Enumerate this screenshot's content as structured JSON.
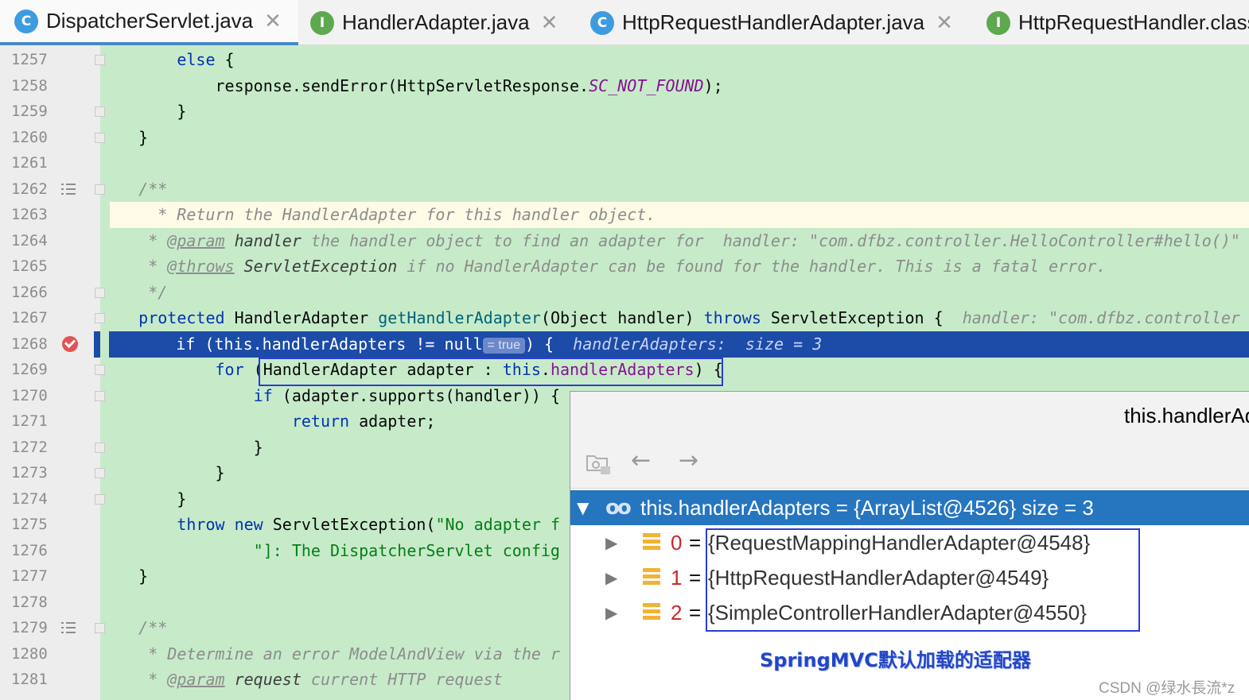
{
  "tabs": [
    {
      "icon": "C",
      "label": "DispatcherServlet.java",
      "active": true
    },
    {
      "icon": "I",
      "label": "HandlerAdapter.java",
      "active": false
    },
    {
      "icon": "C",
      "label": "HttpRequestHandlerAdapter.java",
      "active": false
    },
    {
      "icon": "I",
      "label": "HttpRequestHandler.class",
      "active": false
    }
  ],
  "tab_close_glyph": "✕",
  "lines": [
    "1257",
    "1258",
    "1259",
    "1260",
    "1261",
    "1262",
    "1263",
    "1264",
    "1265",
    "1266",
    "1267",
    "1268",
    "1269",
    "1270",
    "1271",
    "1272",
    "1273",
    "1274",
    "1275",
    "1276",
    "1277",
    "1278",
    "1279",
    "1280",
    "1281"
  ],
  "code": {
    "l1257_else": "else",
    "l1257_brace": " {",
    "l1258_call": "response.sendError(HttpServletResponse.",
    "l1258_const": "SC_NOT_FOUND",
    "l1258_end": ");",
    "l1259": "}",
    "l1260": "}",
    "l1262": "/**",
    "l1263": " * Return the HandlerAdapter for this handler object.",
    "l1264_star": " * ",
    "l1264_tag": "@param",
    "l1264_ref": " handler",
    "l1264_text": " the handler object to find an adapter for",
    "l1264_hint": "  handler: \"com.dfbz.controller.HelloController#hello()\"",
    "l1265_star": " * ",
    "l1265_tag": "@throws",
    "l1265_ref": " ServletException",
    "l1265_text": " if no HandlerAdapter can be found for the handler. This is a fatal error.",
    "l1266": " */",
    "l1267_kw": "protected",
    "l1267_type": " HandlerAdapter ",
    "l1267_fn": "getHandlerAdapter",
    "l1267_args": "(Object handler) ",
    "l1267_throws": "throws",
    "l1267_end": " ServletException {",
    "l1267_hint": "  handler: \"com.dfbz.controller",
    "l1268_code": "if (this.handlerAdapters != null",
    "l1268_pill": "= true",
    "l1268_end": ") {",
    "l1268_hint": "  handlerAdapters:  size = 3",
    "l1269_for": "for",
    "l1269_a": " (HandlerAdapter adapter : ",
    "l1269_this": "this",
    "l1269_dot": ".",
    "l1269_field": "handlerAdapters",
    "l1269_end": ") {",
    "l1270_if": "if",
    "l1270_rest": " (adapter.supports(handler)) {",
    "l1271_ret": "return",
    "l1271_rest": " adapter;",
    "l1272": "}",
    "l1273": "}",
    "l1274": "}",
    "l1275_throw": "throw",
    "l1275_new": " new",
    "l1275_rest": " ServletException(",
    "l1275_str": "\"No adapter f",
    "l1276_str": "\"]: The DispatcherServlet config",
    "l1277": "}",
    "l1279": "/**",
    "l1280": " * Determine an error ModelAndView via the r",
    "l1281_star": " * ",
    "l1281_tag": "@param",
    "l1281_ref": " request",
    "l1281_text": " current HTTP request"
  },
  "popup": {
    "title": "this.handlerAdapters",
    "back_glyph": "←",
    "forward_glyph": "→",
    "root_expand_glyph": "▼",
    "child_expand_glyph": "▶",
    "root_icon_glyph": "oo",
    "root": "this.handlerAdapters = {ArrayList@4526}  size = 3",
    "items": [
      {
        "index": "0",
        "eq": "=",
        "value": "{RequestMappingHandlerAdapter@4548}"
      },
      {
        "index": "1",
        "eq": "=",
        "value": "{HttpRequestHandlerAdapter@4549}"
      },
      {
        "index": "2",
        "eq": "=",
        "value": "{SimpleControllerHandlerAdapter@4550}"
      }
    ],
    "annotation": "SpringMVC默认加载的适配器"
  },
  "watermark": "CSDN @绿水長流*z",
  "colors": {
    "accent": "#4a88c7",
    "execution_line": "#1c4ba8",
    "highlight_box": "#2b3dd6",
    "editor_bg": "#c7ebc9",
    "selected_row": "#2675bf"
  }
}
